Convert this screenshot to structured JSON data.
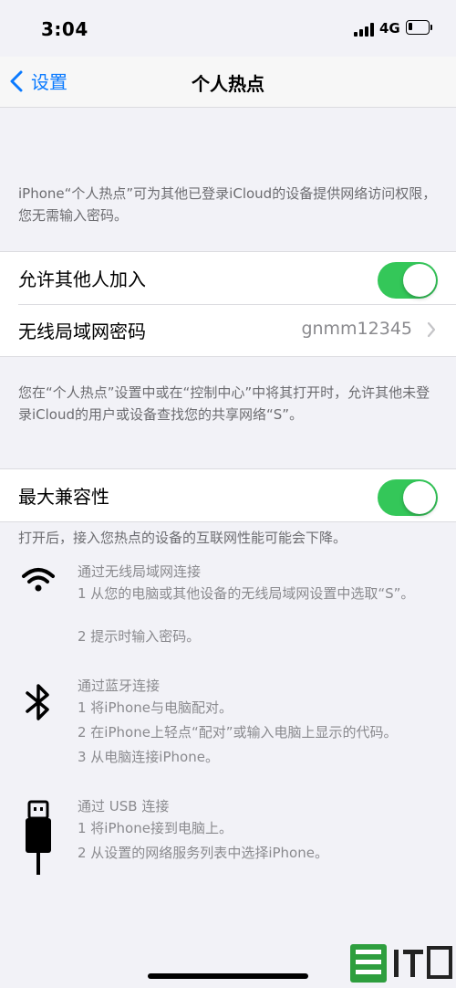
{
  "status_bar": {
    "time": "3:04",
    "network": "4G",
    "signal_bars": 4,
    "battery_level": 0.15
  },
  "nav": {
    "back_label": "设置",
    "title": "个人热点"
  },
  "intro_text": "iPhone“个人热点”可为其他已登录iCloud的设备提供网络访问权限，您无需输入密码。",
  "group1": {
    "allow_others_label": "允许其他人加入",
    "allow_others_on": true,
    "wifi_password_label": "无线局域网密码",
    "wifi_password_value": "gnmm12345"
  },
  "info_text": "您在“个人热点”设置中或在“控制中心”中将其打开时，允许其他未登录iCloud的用户或设备查找您的共享网络“S”。",
  "group2": {
    "max_compat_label": "最大兼容性",
    "max_compat_on": true
  },
  "compat_note": "打开后，接入您热点的设备的互联网性能可能会下降。",
  "connections": {
    "wifi": {
      "title": "通过无线局域网连接",
      "steps": [
        "1 从您的电脑或其他设备的无线局域网设置中选取“S”。",
        "2 提示时输入密码。"
      ]
    },
    "bluetooth": {
      "title": "通过蓝牙连接",
      "steps": [
        "1 将iPhone与电脑配对。",
        "2 在iPhone上轻点“配对”或输入电脑上显示的代码。",
        "3 从电脑连接iPhone。"
      ]
    },
    "usb": {
      "title": "通过 USB 连接",
      "steps": [
        "1 将iPhone接到电脑上。",
        "2 从设置的网络服务列表中选择iPhone。"
      ]
    }
  },
  "colors": {
    "accent": "#0a7aff",
    "toggle_on": "#34c759",
    "secondary_text": "#8a8a8e",
    "background": "#f2f2f7"
  },
  "icons": [
    "wifi-icon",
    "bluetooth-icon",
    "usb-icon",
    "chevron-right-icon",
    "chevron-left-icon"
  ]
}
